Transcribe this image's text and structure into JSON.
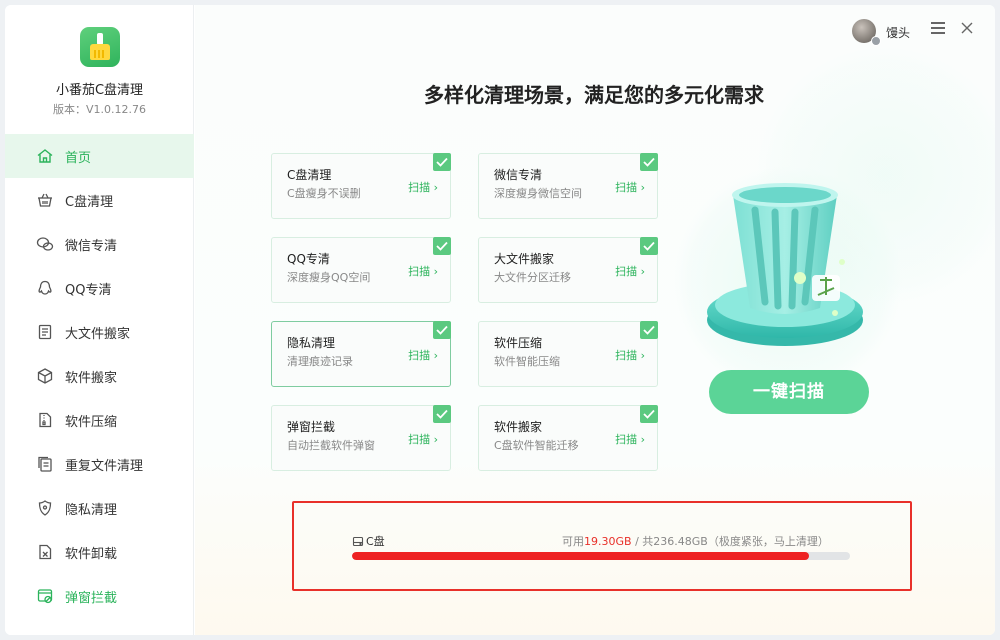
{
  "app": {
    "name": "小番茄C盘清理",
    "version": "版本：V1.0.12.76"
  },
  "sidebar": {
    "items": [
      {
        "label": "首页",
        "icon": "home-icon"
      },
      {
        "label": "C盘清理",
        "icon": "basket-icon"
      },
      {
        "label": "微信专清",
        "icon": "wechat-icon"
      },
      {
        "label": "QQ专清",
        "icon": "qq-icon"
      },
      {
        "label": "大文件搬家",
        "icon": "file-icon"
      },
      {
        "label": "软件搬家",
        "icon": "box-icon"
      },
      {
        "label": "软件压缩",
        "icon": "zip-icon"
      },
      {
        "label": "重复文件清理",
        "icon": "copy-icon"
      },
      {
        "label": "隐私清理",
        "icon": "shield-icon"
      },
      {
        "label": "软件卸载",
        "icon": "uninstall-icon"
      },
      {
        "label": "弹窗拦截",
        "icon": "popup-block-icon"
      }
    ],
    "active_index": 0
  },
  "topbar": {
    "username": "馒头"
  },
  "main": {
    "headline": "多样化清理场景，满足您的多元化需求",
    "cards": [
      {
        "title": "C盘清理",
        "desc": "C盘瘦身不误删",
        "action": "扫描"
      },
      {
        "title": "微信专清",
        "desc": "深度瘦身微信空间",
        "action": "扫描"
      },
      {
        "title": "QQ专清",
        "desc": "深度瘦身QQ空间",
        "action": "扫描"
      },
      {
        "title": "大文件搬家",
        "desc": "大文件分区迁移",
        "action": "扫描"
      },
      {
        "title": "隐私清理",
        "desc": "清理痕迹记录",
        "action": "扫描"
      },
      {
        "title": "软件压缩",
        "desc": "软件智能压缩",
        "action": "扫描"
      },
      {
        "title": "弹窗拦截",
        "desc": "自动拦截软件弹窗",
        "action": "扫描"
      },
      {
        "title": "软件搬家",
        "desc": "C盘软件智能迁移",
        "action": "扫描"
      }
    ],
    "scan_button": "一键扫描"
  },
  "disk": {
    "name": "C盘",
    "free_prefix": "可用",
    "free": "19.30GB",
    "separator": "/",
    "total_text": "共236.48GB",
    "status": "（极度紧张，马上清理）",
    "used_fraction": 0.918
  },
  "colors": {
    "accent": "#2bb35b",
    "warning": "#e8302a"
  }
}
